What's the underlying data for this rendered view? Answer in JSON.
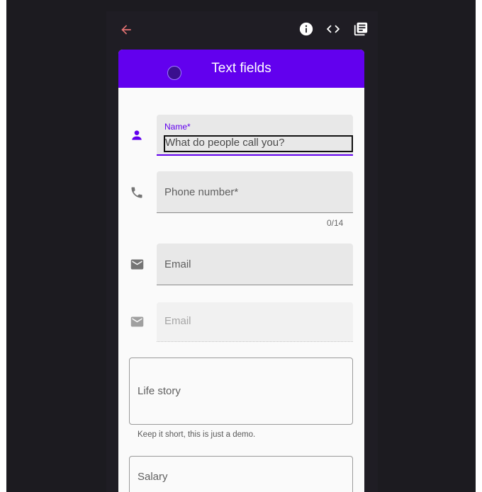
{
  "app": {
    "title": "Text fields"
  },
  "toolbar": {
    "back": "back-arrow-icon",
    "info": "info-icon",
    "code": "code-icon",
    "docs": "library-books-icon"
  },
  "fields": {
    "name": {
      "label": "Name*",
      "value": "What do people call you?",
      "icon": "person-icon"
    },
    "phone": {
      "label": "Phone number*",
      "counter": "0/14",
      "icon": "phone-icon"
    },
    "email": {
      "label": "Email",
      "icon": "mail-icon"
    },
    "email_disabled": {
      "label": "Email",
      "icon": "mail-icon"
    },
    "life_story": {
      "label": "Life story",
      "helper": "Keep it short, this is just a demo."
    },
    "salary": {
      "label": "Salary"
    }
  },
  "colors": {
    "primary": "#6200ee",
    "back_arrow": "#e57373",
    "background": "#1c1b20"
  }
}
